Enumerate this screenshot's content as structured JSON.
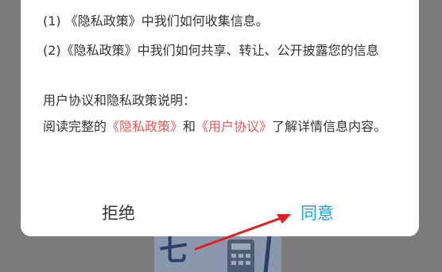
{
  "dialog": {
    "item_1": "(1) 《隐私政策》中我们如何收集信息。",
    "item_2": "(2)《隐私政策》中我们如何共享、转让、公开披露您的信息",
    "section_title": "用户协议和隐私政策说明：",
    "read_prefix": "阅读完整的",
    "privacy_link": "《隐私政策》",
    "and_text": "和",
    "user_agreement_link": "《用户协议》",
    "read_suffix": "了解详情信息内容。"
  },
  "buttons": {
    "reject_label": "拒绝",
    "agree_label": "同意"
  },
  "colors": {
    "accent": "#1aa5d6",
    "link": "#e05a5a",
    "annotation_arrow": "#e02020",
    "overlay": "#7b7b7b"
  },
  "icons": {
    "annotation": "red-arrow-icon"
  }
}
